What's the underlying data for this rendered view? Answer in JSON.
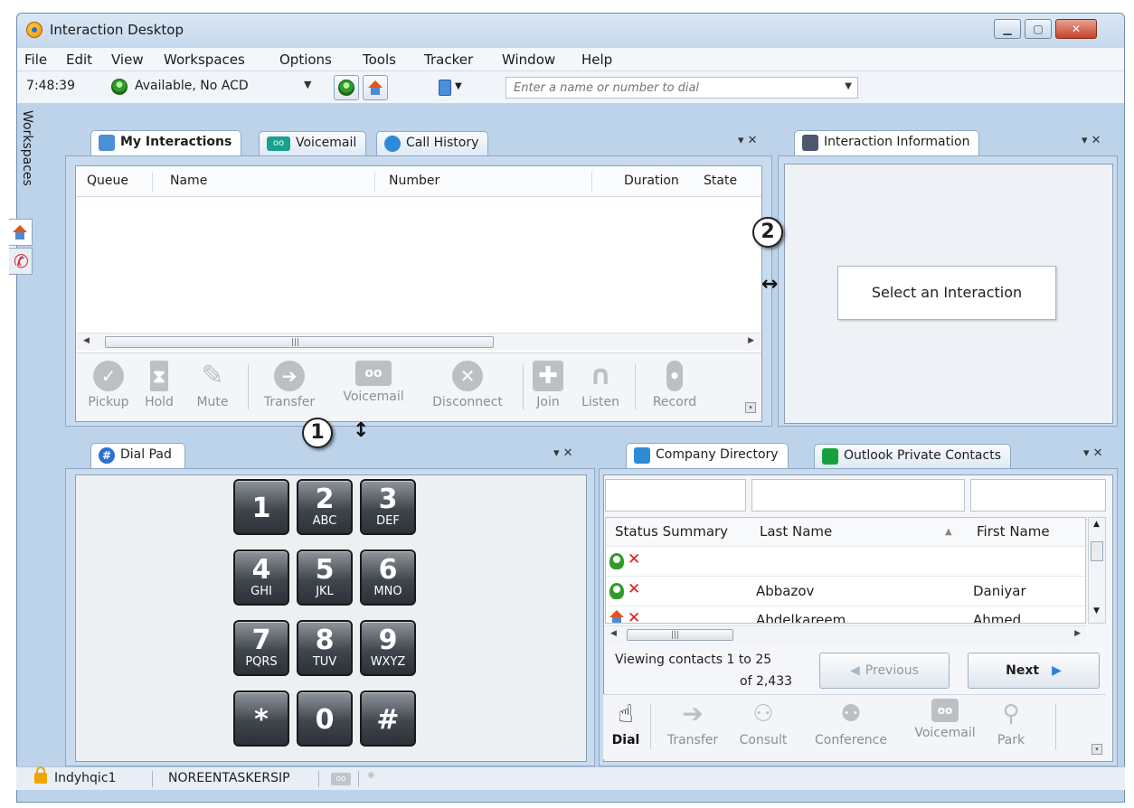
{
  "window": {
    "title": "Interaction Desktop"
  },
  "menu": [
    "File",
    "Edit",
    "View",
    "Workspaces",
    "Options",
    "Tools",
    "Tracker",
    "Window",
    "Help"
  ],
  "toolbar": {
    "time": "7:48:39",
    "status": "Available, No ACD",
    "dial_placeholder": "Enter a name or number to dial"
  },
  "workspaces_label": "Workspaces",
  "interactions_panel": {
    "tabs": [
      "My Interactions",
      "Voicemail",
      "Call History"
    ],
    "columns": [
      "Queue",
      "Name",
      "Number",
      "Duration",
      "State"
    ],
    "actions": [
      "Pickup",
      "Hold",
      "Mute",
      "Transfer",
      "Voicemail",
      "Disconnect",
      "Join",
      "Listen",
      "Record"
    ]
  },
  "info_panel": {
    "tab": "Interaction Information",
    "placeholder": "Select an Interaction"
  },
  "dialpad": {
    "tab": "Dial Pad",
    "keys": [
      {
        "num": "1",
        "letters": ""
      },
      {
        "num": "2",
        "letters": "ABC"
      },
      {
        "num": "3",
        "letters": "DEF"
      },
      {
        "num": "4",
        "letters": "GHI"
      },
      {
        "num": "5",
        "letters": "JKL"
      },
      {
        "num": "6",
        "letters": "MNO"
      },
      {
        "num": "7",
        "letters": "PQRS"
      },
      {
        "num": "8",
        "letters": "TUV"
      },
      {
        "num": "9",
        "letters": "WXYZ"
      },
      {
        "num": "*",
        "letters": ""
      },
      {
        "num": "0",
        "letters": ""
      },
      {
        "num": "#",
        "letters": ""
      }
    ]
  },
  "directory_panel": {
    "tabs": [
      "Company Directory",
      "Outlook Private Contacts"
    ],
    "columns": [
      "Status Summary",
      "Last Name",
      "First Name"
    ],
    "rows": [
      {
        "last": "",
        "first": ""
      },
      {
        "last": "Abbazov",
        "first": "Daniyar"
      },
      {
        "last": "Abdelkareem",
        "first": "Ahmed"
      }
    ],
    "viewing_line1": "Viewing contacts 1 to 25",
    "viewing_line2": "of 2,433",
    "prev": "Previous",
    "next": "Next",
    "actions": [
      "Dial",
      "Transfer",
      "Consult",
      "Conference",
      "Voicemail",
      "Park"
    ]
  },
  "callouts": [
    "1",
    "2"
  ],
  "statusbar": {
    "user": "Indyhqic1",
    "station": "NOREENTASKERSIP"
  },
  "colors": {
    "frame": "#bcd3ea",
    "accent": "#2a70c8",
    "close": "#c5432a"
  }
}
